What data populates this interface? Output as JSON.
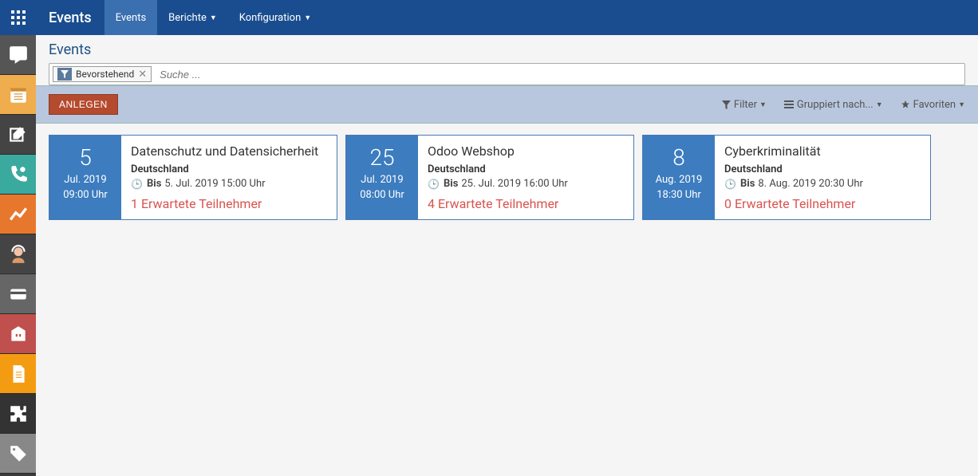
{
  "topbar": {
    "brand": "Events",
    "tabs": [
      "Events",
      "Berichte",
      "Konfiguration"
    ]
  },
  "breadcrumb": "Events",
  "search": {
    "filter_label": "Bevorstehend",
    "placeholder": "Suche ..."
  },
  "controls": {
    "create": "ANLEGEN",
    "filter": "Filter",
    "group": "Gruppiert nach...",
    "favorites": "Favoriten"
  },
  "events": [
    {
      "day": "5",
      "month_year": "Jul. 2019",
      "start_time": "09:00 Uhr",
      "title": "Datenschutz und Datensicherheit",
      "country": "Deutschland",
      "until_label": "Bis",
      "until_value": "5. Jul. 2019 15:00 Uhr",
      "participants": "1 Erwartete Teilnehmer"
    },
    {
      "day": "25",
      "month_year": "Jul. 2019",
      "start_time": "08:00 Uhr",
      "title": "Odoo Webshop",
      "country": "Deutschland",
      "until_label": "Bis",
      "until_value": "25. Jul. 2019 16:00 Uhr",
      "participants": "4 Erwartete Teilnehmer"
    },
    {
      "day": "8",
      "month_year": "Aug. 2019",
      "start_time": "18:30 Uhr",
      "title": "Cyberkriminalität",
      "country": "Deutschland",
      "until_label": "Bis",
      "until_value": "8. Aug. 2019 20:30 Uhr",
      "participants": "0 Erwartete Teilnehmer"
    }
  ]
}
